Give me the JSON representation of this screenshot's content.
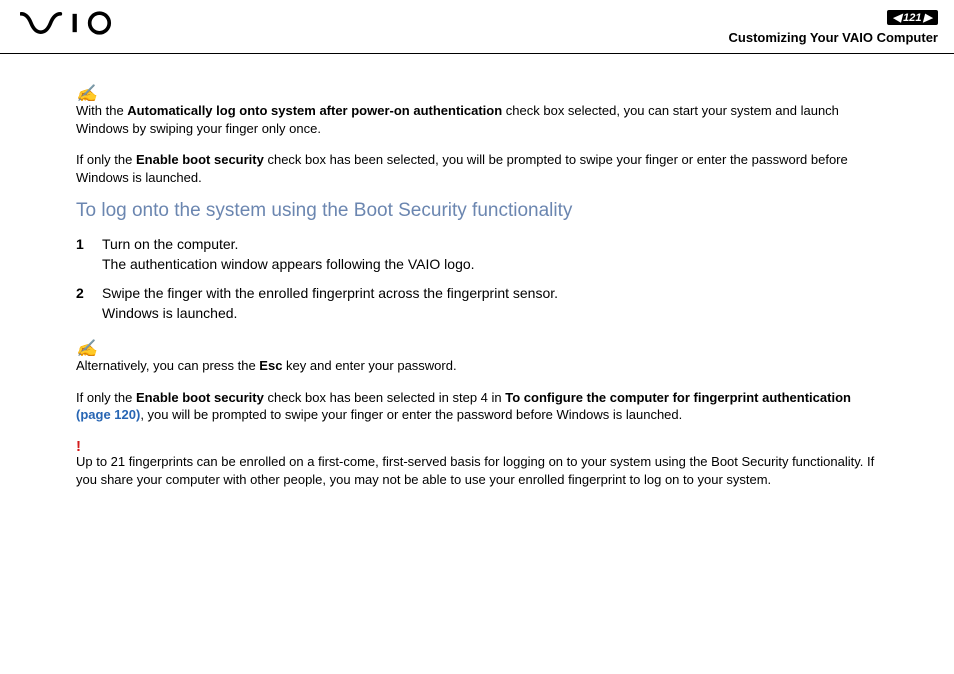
{
  "header": {
    "page_number": "121",
    "section_title": "Customizing Your VAIO Computer"
  },
  "content": {
    "note1_prefix": "With the ",
    "note1_bold": "Automatically log onto system after power-on authentication",
    "note1_suffix": " check box selected, you can start your system and launch Windows by swiping your finger only once.",
    "note2_prefix": "If only the ",
    "note2_bold": "Enable boot security",
    "note2_suffix": " check box has been selected, you will be prompted to swipe your finger or enter the password before Windows is launched.",
    "heading": "To log onto the system using the Boot Security functionality",
    "step1_num": "1",
    "step1_line1": "Turn on the computer.",
    "step1_line2": "The authentication window appears following the VAIO logo.",
    "step2_num": "2",
    "step2_line1": "Swipe the finger with the enrolled fingerprint across the fingerprint sensor.",
    "step2_line2": "Windows is launched.",
    "note3_prefix": "Alternatively, you can press the ",
    "note3_bold": "Esc",
    "note3_suffix": " key and enter your password.",
    "note4_prefix": "If only the ",
    "note4_bold1": "Enable boot security",
    "note4_mid": " check box has been selected in step 4 in ",
    "note4_bold2": "To configure the computer for fingerprint authentication ",
    "note4_link": "(page 120)",
    "note4_suffix": ", you will be prompted to swipe your finger or enter the password before Windows is launched.",
    "warn_text": "Up to 21 fingerprints can be enrolled on a first-come, first-served basis for logging on to your system using the Boot Security functionality. If you share your computer with other people, you may not be able to use your enrolled fingerprint to log on to your system."
  }
}
